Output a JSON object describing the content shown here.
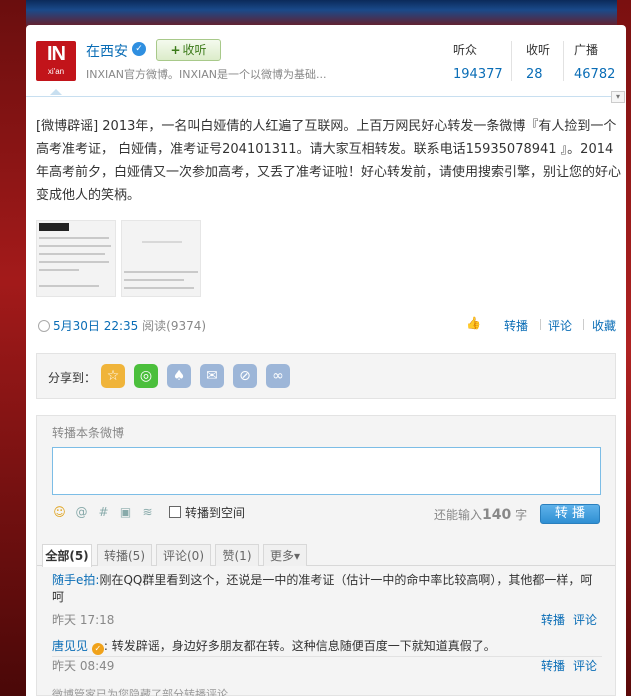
{
  "profile": {
    "avatar_text": "IN",
    "avatar_sub": "xi'an",
    "name": "在西安",
    "follow_label": "收听",
    "description": "INXIAN官方微博。INXIAN是一个以微博为基础..."
  },
  "stats": [
    {
      "label": "听众",
      "value": "194377"
    },
    {
      "label": "收听",
      "value": "28"
    },
    {
      "label": "广播",
      "value": "46782"
    }
  ],
  "post": {
    "text": "[微博辟谣] 2013年，一名叫白娅倩的人红遍了互联网。上百万网民好心转发一条微博『有人捡到一个高考准考证， 白娅倩，准考证号204101311。请大家互相转发。联系电话15935078941 』。2014年高考前夕，白娅倩又一次参加高考，又丢了准考证啦！好心转发前，请使用搜索引擎，别让您的好心变成他人的笑柄。",
    "date": "5月30日 22:35",
    "reads": "阅读(9374)",
    "actions": {
      "repost": "转播",
      "comment": "评论",
      "favorite": "收藏"
    }
  },
  "share": {
    "label": "分享到：",
    "icons": [
      "qzone-star-icon",
      "wechat-icon",
      "qq-icon",
      "email-icon",
      "tencent-weibo-icon",
      "link-icon"
    ],
    "colors": [
      "#f0b43a",
      "#4bbf3c",
      "#9db6d8",
      "#9db6d8",
      "#9db6d8",
      "#9db6d8"
    ]
  },
  "repost": {
    "title": "转播本条微博",
    "input_value": "",
    "checkbox_label": "转播到空间",
    "remain_prefix": "还能输入",
    "remain_count": "140",
    "remain_suffix": "字",
    "button": "转 播"
  },
  "tabs": [
    {
      "label": "全部(5)",
      "active": true
    },
    {
      "label": "转播(5)",
      "active": false
    },
    {
      "label": "评论(0)",
      "active": false
    },
    {
      "label": "赞(1)",
      "active": false
    },
    {
      "label": "更多▾",
      "active": false
    }
  ],
  "comments": [
    {
      "name": "随手e拍:",
      "text": "刚在QQ群里看到这个，还说是一中的准考证（估计一中的命中率比较高啊），其他都一样，呵呵",
      "time": "昨天 17:18",
      "repost": "转播",
      "comment": "评论"
    },
    {
      "name": "唐见见",
      "text": ": 转发辟谣，身边好多朋友都在转。这种信息随便百度一下就知道真假了。",
      "time": "昨天 08:49",
      "repost": "转播",
      "comment": "评论"
    }
  ],
  "notice": "微博管家已为您隐藏了部分转播评论"
}
